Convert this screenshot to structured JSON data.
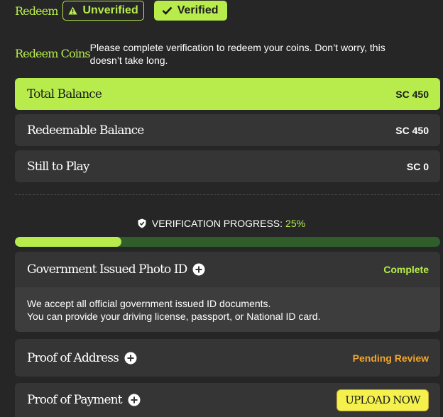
{
  "header": {
    "redeem_label": "Redeem",
    "tabs": [
      {
        "label": "Unverified",
        "icon": "warning-icon"
      },
      {
        "label": "Verified",
        "icon": "check-icon"
      }
    ]
  },
  "intro": {
    "title": "Redeem Coins",
    "text": "Please complete verification to redeem your coins. Don’t worry, this doesn’t take long."
  },
  "balances": [
    {
      "label": "Total Balance",
      "value": "SC 450"
    },
    {
      "label": "Redeemable Balance",
      "value": "SC 450"
    },
    {
      "label": "Still to Play",
      "value": "SC 0"
    }
  ],
  "verification": {
    "label": "VERIFICATION PROGRESS:",
    "percent_text": "25%",
    "progress": 0.25,
    "icon": "shield-check-icon"
  },
  "documents": [
    {
      "title": "Government Issued Photo ID",
      "status": "Complete",
      "description_lines": [
        "We accept all official government issued ID documents.",
        "You can provide your driving license, passport, or National ID card."
      ]
    },
    {
      "title": "Proof of Address",
      "status": "Pending Review"
    },
    {
      "title": "Proof of Payment",
      "action": "UPLOAD NOW"
    }
  ],
  "colors": {
    "background": "#262626",
    "accent": "#b7ec4c",
    "card": "#353535",
    "pending": "#f2a52b",
    "upload": "#f4f04d",
    "progress_track": "#2f5e2b"
  }
}
